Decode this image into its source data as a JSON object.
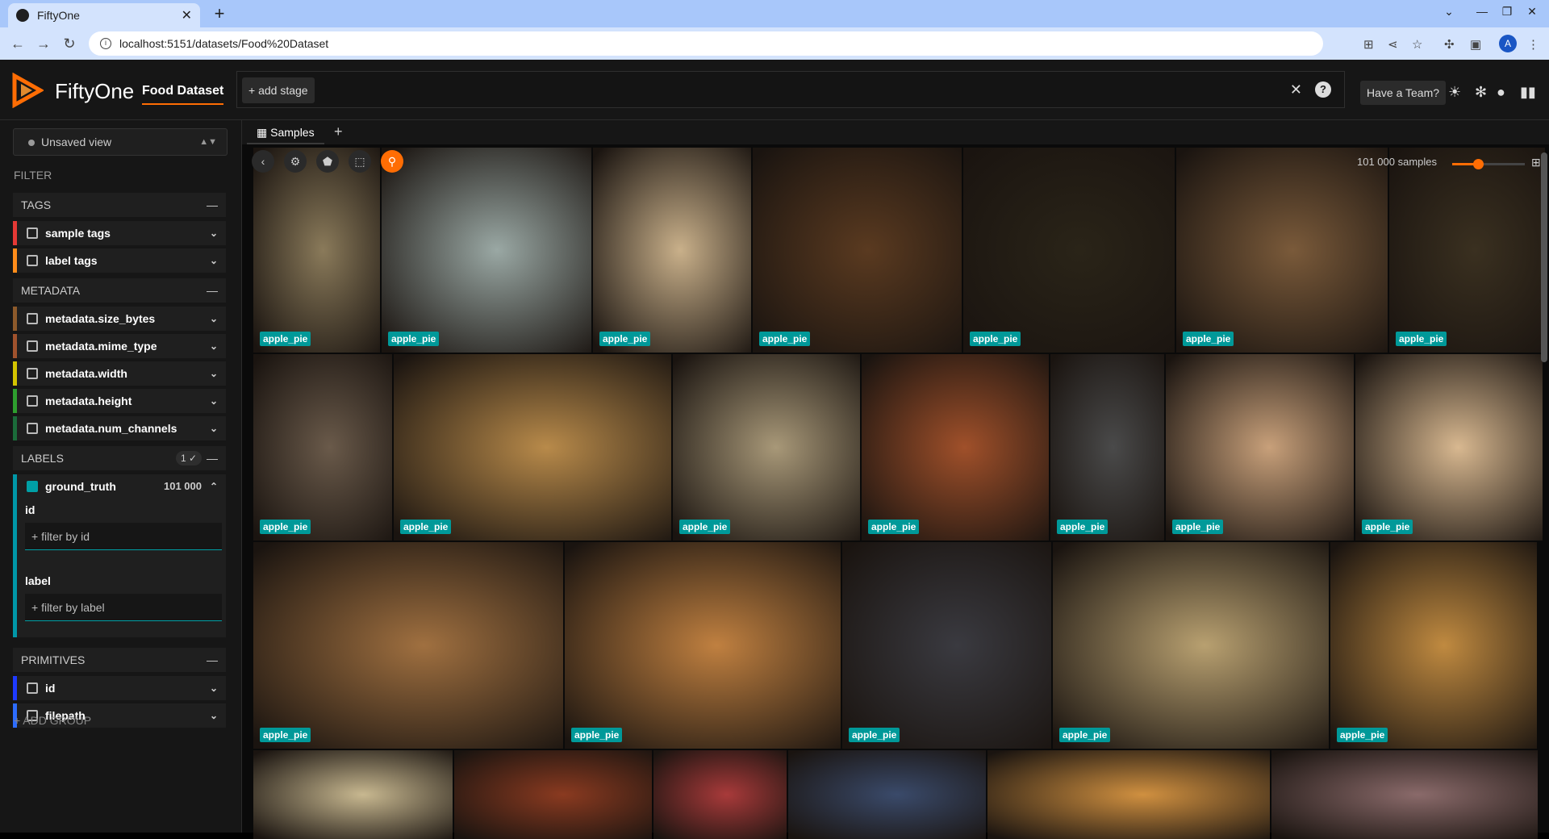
{
  "browser": {
    "tab_title": "FiftyOne",
    "url": "localhost:5151/datasets/Food%20Dataset",
    "avatar_letter": "A"
  },
  "header": {
    "app_name": "FiftyOne",
    "dataset_name": "Food Dataset",
    "add_stage_label": "+ add stage",
    "have_team_label": "Have a Team?"
  },
  "sidebar": {
    "view_select": "Unsaved view",
    "filter_title": "FILTER",
    "groups": {
      "tags": "TAGS",
      "metadata": "METADATA",
      "labels": "LABELS",
      "labels_badge": "1 ✓",
      "primitives": "PRIMITIVES"
    },
    "fields": {
      "sample_tags": "sample tags",
      "label_tags": "label tags",
      "size_bytes": "metadata.size_bytes",
      "mime_type": "metadata.mime_type",
      "width": "metadata.width",
      "height": "metadata.height",
      "num_channels": "metadata.num_channels",
      "ground_truth": "ground_truth",
      "ground_truth_count": "101 000",
      "id": "id",
      "filepath": "filepath"
    },
    "gt_filters": {
      "id_label": "id",
      "id_placeholder": "+ filter by id",
      "label_label": "label",
      "label_placeholder": "+ filter by label"
    },
    "add_group": "+ ADD GROUP"
  },
  "grid": {
    "tab_label": "Samples",
    "sample_count": "101 000 samples",
    "zoom_level": 0.35,
    "tile_label": "apple_pie"
  },
  "colors": {
    "accent": "#ff6d04",
    "label_badge": "#009999",
    "tags_bar": "#e53935",
    "metadata_bar": "#8d5a2b",
    "labels_bar": "#0097a7",
    "primitives_bar": "#1e3aff"
  }
}
